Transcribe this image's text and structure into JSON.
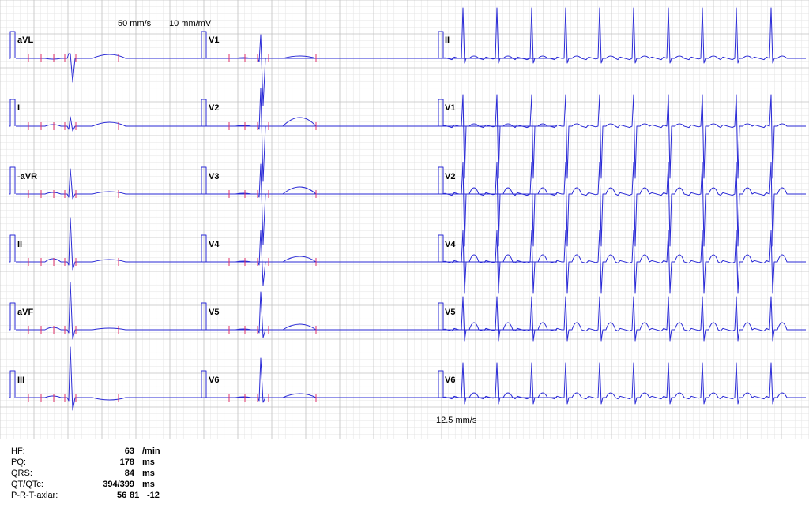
{
  "header": {
    "paper_speed": "50 mm/s",
    "gain": "10 mm/mV",
    "rhythm_speed": "12.5 mm/s"
  },
  "colors": {
    "grid_minor": "#e4e4e4",
    "grid_major": "#c4c4c4",
    "trace": "#2a2ad6",
    "marker": "#e0306a"
  },
  "leads": {
    "left": [
      "aVL",
      "I",
      "-aVR",
      "II",
      "aVF",
      "III"
    ],
    "middle": [
      "V1",
      "V2",
      "V3",
      "V4",
      "V5",
      "V6"
    ],
    "rhythm": [
      "II",
      "V1",
      "V2",
      "V4",
      "V5",
      "V6"
    ]
  },
  "measurements": [
    {
      "label": "HF:",
      "value": "63",
      "unit": "/min"
    },
    {
      "label": "PQ:",
      "value": "178",
      "unit": "ms"
    },
    {
      "label": "QRS:",
      "value": "84",
      "unit": "ms"
    },
    {
      "label": "QT/QTc:",
      "value": "394/399",
      "unit": "ms"
    }
  ],
  "axes": {
    "label": "P-R-T-axlar:",
    "p": "56",
    "r": "81",
    "t": "-12"
  }
}
